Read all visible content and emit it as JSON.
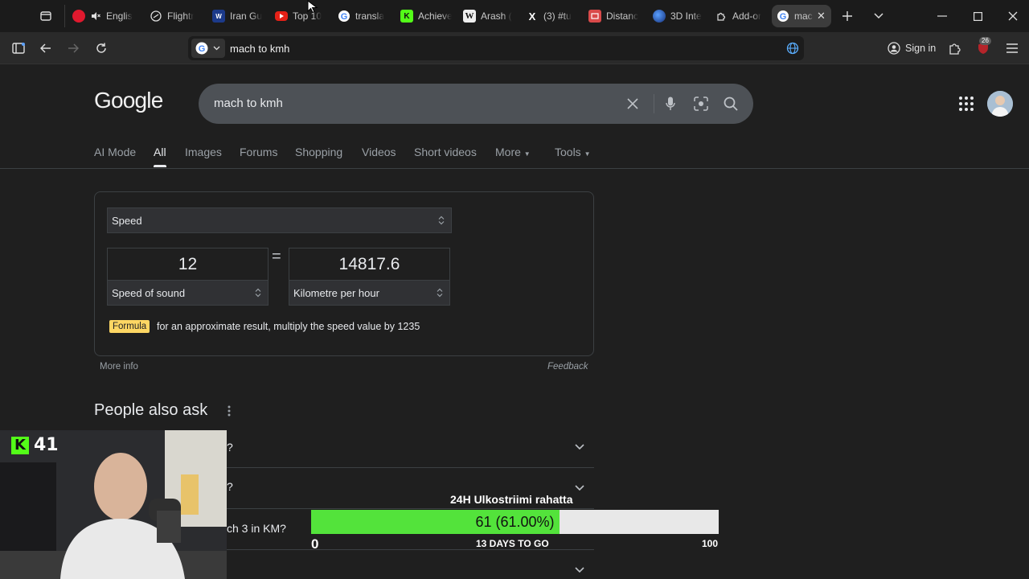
{
  "browser": {
    "tabs": [
      {
        "label": "Englis",
        "favicon": "vivaldi-red",
        "muted": true
      },
      {
        "label": "Flightr",
        "favicon": "plane-icon"
      },
      {
        "label": "Iran Gu",
        "favicon": "flag-icon"
      },
      {
        "label": "Top 10",
        "favicon": "youtube-icon"
      },
      {
        "label": "transla",
        "favicon": "google-icon"
      },
      {
        "label": "Achieve",
        "favicon": "kick-icon"
      },
      {
        "label": "Arash (",
        "favicon": "wikipedia-icon"
      },
      {
        "label": "(3) #tu",
        "favicon": "x-icon"
      },
      {
        "label": "Distanc",
        "favicon": "map-icon"
      },
      {
        "label": "3D Inte",
        "favicon": "globe-icon"
      },
      {
        "label": "Add-or",
        "favicon": "puzzle-icon"
      },
      {
        "label": "mac",
        "favicon": "google-icon",
        "active": true
      }
    ],
    "address": "mach to kmh",
    "signin_label": "Sign in",
    "notification_count": "26"
  },
  "google": {
    "logo": "Google",
    "query": "mach to kmh",
    "nav_tabs": [
      {
        "label": "AI Mode"
      },
      {
        "label": "All",
        "active": true
      },
      {
        "label": "Images"
      },
      {
        "label": "Forums"
      },
      {
        "label": "Shopping"
      },
      {
        "label": "Videos"
      },
      {
        "label": "Short videos"
      },
      {
        "label": "More"
      },
      {
        "label": "Tools"
      }
    ]
  },
  "converter": {
    "category": "Speed",
    "from_value": "12",
    "to_value": "14817.6",
    "equals": "=",
    "from_unit": "Speed of sound",
    "to_unit": "Kilometre per hour",
    "formula_tag": "Formula",
    "formula_text": "for an approximate result, multiply the speed value by 1235",
    "more_info": "More info",
    "feedback": "Feedback"
  },
  "paa": {
    "title": "People also ask",
    "questions": [
      {
        "text": "?"
      },
      {
        "text": "?"
      },
      {
        "text": "ch 3 in KM?"
      },
      {
        "text": ""
      }
    ]
  },
  "overlay": {
    "kick_count": "41",
    "goal_title": "24H Ulkostriimi rahatta",
    "goal_value": "61 (61.00%)",
    "goal_fraction": 0.61,
    "goal_min": "0",
    "goal_days": "13 DAYS TO GO",
    "goal_max": "100"
  },
  "colors": {
    "page_bg": "#1f1f1f",
    "search_bg": "#4d5156",
    "formula_tag": "#fdd663",
    "kick_green": "#53fc18",
    "goal_fill": "#53e33b"
  }
}
